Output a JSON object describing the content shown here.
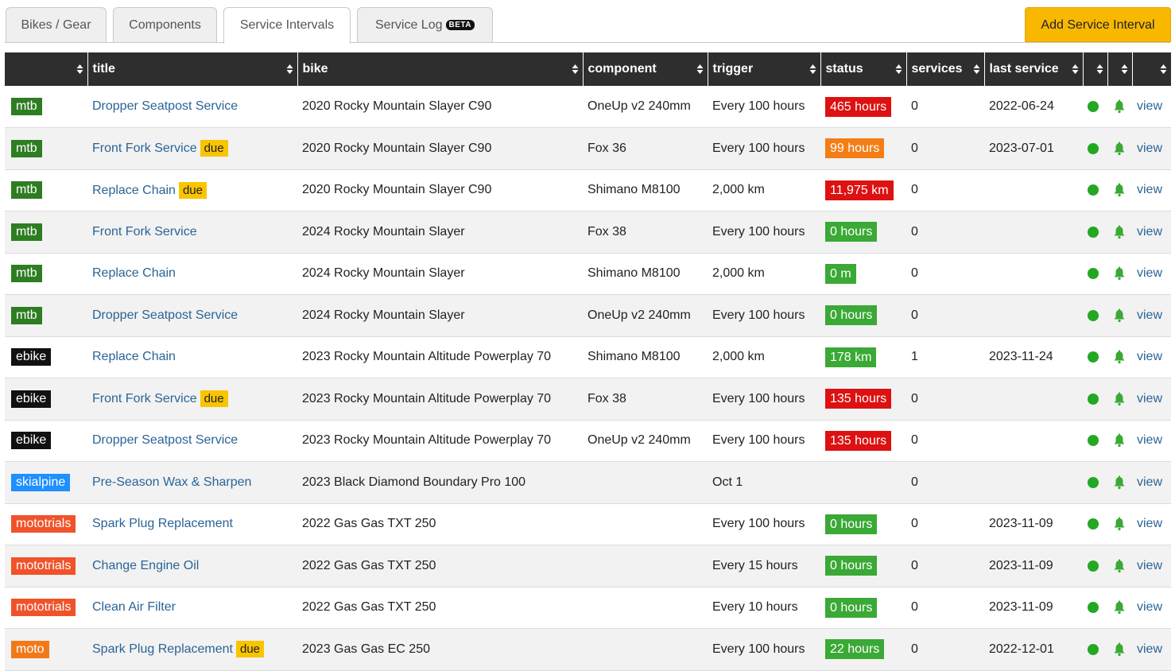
{
  "tabs": [
    {
      "label": "Bikes / Gear",
      "active": false
    },
    {
      "label": "Components",
      "active": false
    },
    {
      "label": "Service Intervals",
      "active": true
    },
    {
      "label": "Service Log",
      "badge": "BETA",
      "active": false
    }
  ],
  "add_button": "Add Service Interval",
  "columns": [
    "",
    "title",
    "bike",
    "component",
    "trigger",
    "status",
    "services",
    "last service",
    "",
    "",
    ""
  ],
  "sort_icon": "sort-updown-icon",
  "type_colors": {
    "mtb": "#2e7d22",
    "ebike": "#111111",
    "skialpine": "#1e90ff",
    "mototrials": "#f0532a",
    "moto": "#f07a1a"
  },
  "status_colors": {
    "red": "#dd1111",
    "orange": "#f47e16",
    "green": "#3aa935"
  },
  "rows": [
    {
      "type": "mtb",
      "title": "Dropper Seatpost Service",
      "due": "",
      "bike": "2020 Rocky Mountain Slayer C90",
      "component": "OneUp v2 240mm",
      "trigger": "Every 100 hours",
      "status": "465 hours",
      "status_color": "red",
      "services": "0",
      "last_service": "2022-06-24",
      "action": "view"
    },
    {
      "type": "mtb",
      "title": "Front Fork Service",
      "due": "due",
      "bike": "2020 Rocky Mountain Slayer C90",
      "component": "Fox 36",
      "trigger": "Every 100 hours",
      "status": "99 hours",
      "status_color": "orange",
      "services": "0",
      "last_service": "2023-07-01",
      "action": "view"
    },
    {
      "type": "mtb",
      "title": "Replace Chain",
      "due": "due",
      "bike": "2020 Rocky Mountain Slayer C90",
      "component": "Shimano M8100",
      "trigger": "2,000 km",
      "status": "11,975 km",
      "status_color": "red",
      "services": "0",
      "last_service": "",
      "action": "view"
    },
    {
      "type": "mtb",
      "title": "Front Fork Service",
      "due": "",
      "bike": "2024 Rocky Mountain Slayer",
      "component": "Fox 38",
      "trigger": "Every 100 hours",
      "status": "0 hours",
      "status_color": "green",
      "services": "0",
      "last_service": "",
      "action": "view"
    },
    {
      "type": "mtb",
      "title": "Replace Chain",
      "due": "",
      "bike": "2024 Rocky Mountain Slayer",
      "component": "Shimano M8100",
      "trigger": "2,000 km",
      "status": "0 m",
      "status_color": "green",
      "services": "0",
      "last_service": "",
      "action": "view"
    },
    {
      "type": "mtb",
      "title": "Dropper Seatpost Service",
      "due": "",
      "bike": "2024 Rocky Mountain Slayer",
      "component": "OneUp v2 240mm",
      "trigger": "Every 100 hours",
      "status": "0 hours",
      "status_color": "green",
      "services": "0",
      "last_service": "",
      "action": "view"
    },
    {
      "type": "ebike",
      "title": "Replace Chain",
      "due": "",
      "bike": "2023 Rocky Mountain Altitude Powerplay 70",
      "component": "Shimano M8100",
      "trigger": "2,000 km",
      "status": "178 km",
      "status_color": "green",
      "services": "1",
      "last_service": "2023-11-24",
      "action": "view"
    },
    {
      "type": "ebike",
      "title": "Front Fork Service",
      "due": "due",
      "bike": "2023 Rocky Mountain Altitude Powerplay 70",
      "component": "Fox 38",
      "trigger": "Every 100 hours",
      "status": "135 hours",
      "status_color": "red",
      "services": "0",
      "last_service": "",
      "action": "view"
    },
    {
      "type": "ebike",
      "title": "Dropper Seatpost Service",
      "due": "",
      "bike": "2023 Rocky Mountain Altitude Powerplay 70",
      "component": "OneUp v2 240mm",
      "trigger": "Every 100 hours",
      "status": "135 hours",
      "status_color": "red",
      "services": "0",
      "last_service": "",
      "action": "view"
    },
    {
      "type": "skialpine",
      "title": "Pre-Season Wax & Sharpen",
      "due": "",
      "bike": "2023 Black Diamond Boundary Pro 100",
      "component": "",
      "trigger": "Oct 1",
      "status": "",
      "status_color": "",
      "services": "0",
      "last_service": "",
      "action": "view"
    },
    {
      "type": "mototrials",
      "title": "Spark Plug Replacement",
      "due": "",
      "bike": "2022 Gas Gas TXT 250",
      "component": "",
      "trigger": "Every 100 hours",
      "status": "0 hours",
      "status_color": "green",
      "services": "0",
      "last_service": "2023-11-09",
      "action": "view"
    },
    {
      "type": "mototrials",
      "title": "Change Engine Oil",
      "due": "",
      "bike": "2022 Gas Gas TXT 250",
      "component": "",
      "trigger": "Every 15 hours",
      "status": "0 hours",
      "status_color": "green",
      "services": "0",
      "last_service": "2023-11-09",
      "action": "view"
    },
    {
      "type": "mototrials",
      "title": "Clean Air Filter",
      "due": "",
      "bike": "2022 Gas Gas TXT 250",
      "component": "",
      "trigger": "Every 10 hours",
      "status": "0 hours",
      "status_color": "green",
      "services": "0",
      "last_service": "2023-11-09",
      "action": "view"
    },
    {
      "type": "moto",
      "title": "Spark Plug Replacement",
      "due": "due",
      "bike": "2023 Gas Gas EC 250",
      "component": "",
      "trigger": "Every 100 hours",
      "status": "22 hours",
      "status_color": "green",
      "services": "0",
      "last_service": "2022-12-01",
      "action": "view"
    }
  ]
}
